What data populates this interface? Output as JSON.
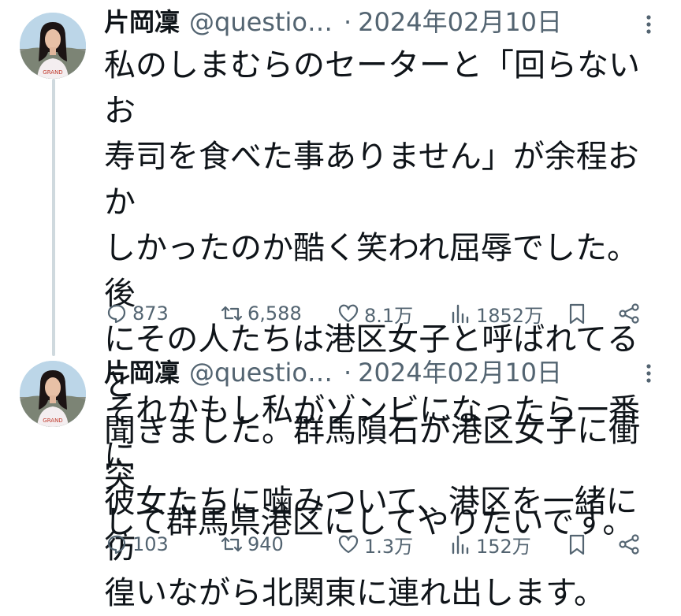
{
  "tweets": [
    {
      "author_name": "片岡凜",
      "handle": "@questio…",
      "separator": "·",
      "date": "2024年02月10日",
      "text": "私のしまむらのセーターと「回らないお\n寿司を食べた事ありません」が余程おか\nしかったのか酷く笑われ屈辱でした。後\nにその人たちは港区女子と呼ばれてると\n聞きました。群馬隕石が港区女子に衝突\nして群馬県港区にしてやりたいです。",
      "replies": "873",
      "reposts": "6,588",
      "likes": "8.1万",
      "views": "1852万"
    },
    {
      "author_name": "片岡凜",
      "handle": "@questio…",
      "separator": "·",
      "date": "2024年02月10日",
      "text": "それかもし私がゾンビになったら一番に\n彼女たちに噛みついて、港区を一緒に彷\n徨いながら北関東に連れ出します。",
      "replies": "103",
      "reposts": "940",
      "likes": "1.3万",
      "views": "152万"
    }
  ],
  "colors": {
    "text_primary": "#0f1419",
    "text_secondary": "#536471",
    "thread_line": "#cfd9de",
    "background": "#ffffff"
  },
  "icons": [
    "reply-icon",
    "repost-icon",
    "like-icon",
    "views-icon",
    "bookmark-icon",
    "share-icon",
    "more-icon"
  ]
}
